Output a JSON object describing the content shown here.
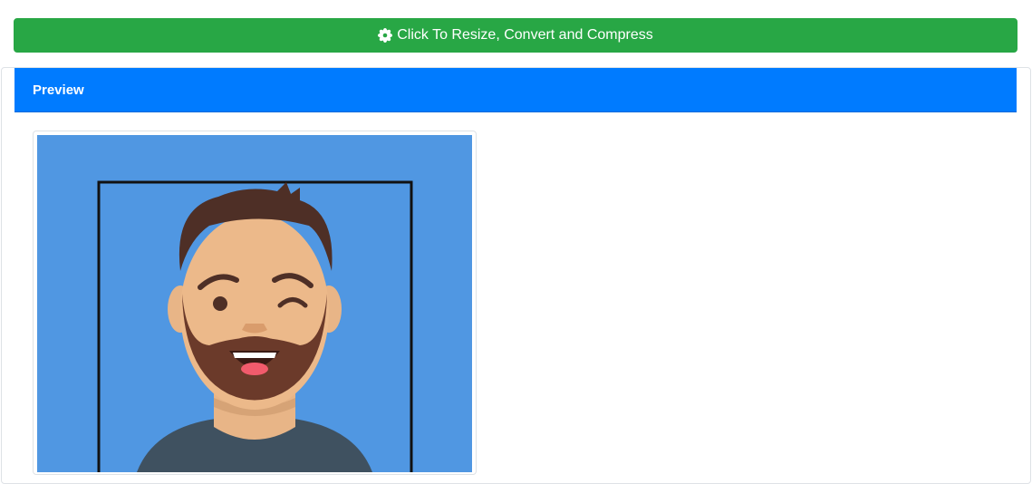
{
  "toolbar": {
    "action_label": "Click To Resize, Convert and Compress",
    "action_icon": "gear-icon",
    "action_color": "#28a745"
  },
  "preview": {
    "header_label": "Preview",
    "header_color": "#007bff",
    "image_description_icon": "avatar-image"
  }
}
